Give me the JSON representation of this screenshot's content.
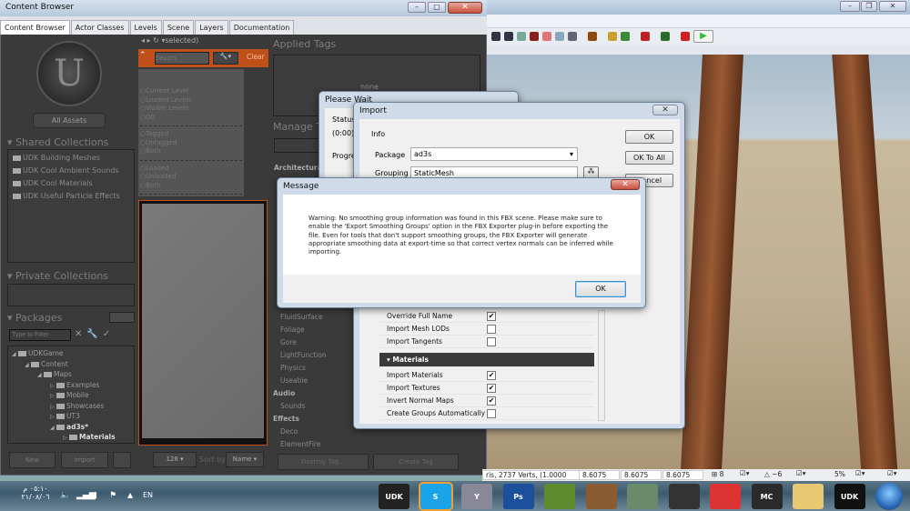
{
  "editor": {
    "toolbar_icons": [
      "kismet-icon",
      "kismet-icon",
      "search-icon",
      "actor-icon",
      "light-icon",
      "browser-icon",
      "sound-icon",
      "matinee-icon",
      "build-icon",
      "build-all-icon",
      "lighting-icon",
      "cook-icon",
      "record-icon",
      "play-icon"
    ]
  },
  "content_browser": {
    "title": "Content Browser",
    "tabs": [
      "Content Browser",
      "Actor Classes",
      "Levels",
      "Scene",
      "Layers",
      "Documentation"
    ],
    "all_assets": "All Assets",
    "shared_collections": {
      "title": "Shared Collections",
      "items": [
        "UDK Building Meshes",
        "UDK Cool Ambient Sounds",
        "UDK Cool Materials",
        "UDK Useful Particle Effects"
      ]
    },
    "private_collections": {
      "title": "Private Collections"
    },
    "packages": {
      "title": "Packages",
      "filter_placeholder": "Type to Filter",
      "tree": [
        {
          "label": "UDKGame",
          "depth": 0,
          "expanded": true
        },
        {
          "label": "Content",
          "depth": 1,
          "expanded": true
        },
        {
          "label": "Maps",
          "depth": 2,
          "expanded": true
        },
        {
          "label": "Examples",
          "depth": 3
        },
        {
          "label": "Mobile",
          "depth": 3
        },
        {
          "label": "Showcases",
          "depth": 3
        },
        {
          "label": "UT3",
          "depth": 3
        },
        {
          "label": "ad3s*",
          "depth": 3,
          "expanded": true,
          "bold": true
        },
        {
          "label": "Materials",
          "depth": 4,
          "bold": true
        }
      ]
    },
    "new_button": "New",
    "import_button": "Import",
    "selected_label": "selected)",
    "search_placeholder": "Search",
    "clear_button": "Clear",
    "filters": {
      "group1": [
        "Current Level",
        "Loaded Levels",
        "Visible Levels",
        "Off"
      ],
      "group2": [
        "Tagged",
        "Untagged",
        "Both"
      ],
      "group3": [
        "Loaded",
        "Unloaded",
        "Both"
      ]
    },
    "thumb_size": "128",
    "sort_by_label": "Sort by",
    "sort_value": "Name",
    "applied_tags": {
      "title": "Applied Tags",
      "value": "none"
    },
    "manage_tags": {
      "title": "Manage T",
      "categories": [
        {
          "header": "Architectura",
          "items": []
        },
        {
          "header": "",
          "items": [
            "FluidSurface",
            "Foliage",
            "Gore",
            "LightFunction",
            "Physics",
            "Useable"
          ]
        },
        {
          "header": "Audio",
          "items": [
            "Sounds"
          ]
        },
        {
          "header": "Effects",
          "items": [
            "Deco",
            "ElementFire"
          ]
        }
      ]
    },
    "destroy_tag": "Destroy Tag...",
    "create_tag": "Create Tag"
  },
  "please_wait": {
    "title": "Please Wait",
    "status": "Status",
    "time": "(0:00)",
    "progress": "Progre"
  },
  "import": {
    "title": "Import",
    "info": "Info",
    "package_label": "Package",
    "package_value": "ad3s",
    "grouping_label": "Grouping",
    "grouping_value": "StaticMesh",
    "ok": "OK",
    "ok_to_all": "OK To All",
    "cancel": "Cancel",
    "properties": [
      {
        "label": "Override Full Name",
        "checked": true
      },
      {
        "label": "Import Mesh LODs",
        "checked": false
      },
      {
        "label": "Import Tangents",
        "checked": false
      }
    ],
    "materials_header": "Materials",
    "materials": [
      {
        "label": "Import Materials",
        "checked": true
      },
      {
        "label": "Import Textures",
        "checked": true
      },
      {
        "label": "Invert Normal Maps",
        "checked": true
      },
      {
        "label": "Create Groups Automatically",
        "checked": false
      }
    ]
  },
  "message": {
    "title": "Message",
    "text": "Warning: No smoothing group information was found in this FBX scene.  Please make sure to enable the 'Export Smoothing Groups' option in the FBX Exporter plug-in before exporting the file.  Even for tools that don't support smoothing groups, the FBX Exporter will generate appropriate smoothing data at export-time so that correct vertex normals can be inferred while importing.",
    "ok": "OK"
  },
  "status_bar": {
    "info": "ris, 2737 Verts, (1.0000",
    "values": [
      "8.6075",
      "8.6075",
      "8.6075"
    ],
    "grid": "8",
    "rotation": "~6",
    "scale": "5%"
  },
  "taskbar": {
    "time": "٠٥:١٠ م",
    "date": "٢١/٠٨/٠٦",
    "language": "EN",
    "apps": [
      {
        "name": "udk-icon",
        "label": "UDK",
        "color": "#222"
      },
      {
        "name": "skype-icon",
        "label": "S",
        "color": "#1aa3e8"
      },
      {
        "name": "app-y-icon",
        "label": "Y",
        "color": "#889"
      },
      {
        "name": "photoshop-icon",
        "label": "Ps",
        "color": "#1c4f9c"
      },
      {
        "name": "minecraft-icon",
        "label": "",
        "color": "#5c8a2c"
      },
      {
        "name": "game-icon",
        "label": "",
        "color": "#8a5a30"
      },
      {
        "name": "record-app-icon",
        "label": "",
        "color": "#6a8a6a"
      },
      {
        "name": "app-horse-icon",
        "label": "",
        "color": "#333"
      },
      {
        "name": "chrome-icon",
        "label": "",
        "color": "#d33"
      },
      {
        "name": "mc-icon",
        "label": "MC",
        "color": "#2a2a2a"
      },
      {
        "name": "explorer-icon",
        "label": "",
        "color": "#e8c870"
      },
      {
        "name": "udk-icon",
        "label": "UDK",
        "color": "#111"
      }
    ]
  }
}
